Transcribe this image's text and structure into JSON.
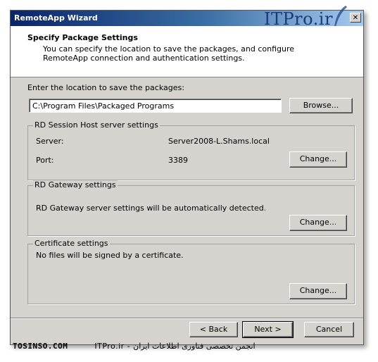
{
  "window": {
    "title": "RemoteApp Wizard",
    "logo": "ITPro.ir",
    "close_glyph": "✕"
  },
  "header": {
    "title": "Specify Package Settings",
    "description": "You can specify the location to save the packages, and configure RemoteApp connection and authentication settings."
  },
  "location": {
    "label": "Enter the location to save the packages:",
    "value": "C:\\Program Files\\Packaged Programs",
    "browse_label": "Browse..."
  },
  "rd_session": {
    "legend": "RD Session Host server settings",
    "server_label": "Server:",
    "server_value": "Server2008-L.Shams.local",
    "port_label": "Port:",
    "port_value": "3389",
    "change_label": "Change..."
  },
  "rd_gateway": {
    "legend": "RD Gateway settings",
    "text": "RD Gateway server settings will be automatically detected.",
    "change_label": "Change..."
  },
  "certificate": {
    "legend": "Certificate settings",
    "text": "No files will be signed by a certificate.",
    "change_label": "Change..."
  },
  "footer": {
    "back_label": "< Back",
    "next_label": "Next >",
    "cancel_label": "Cancel"
  },
  "watermark": {
    "left": "TOSINSO.COM",
    "right": "ITPro.ir - انجمن تخصصی فناوری اطلاعات ایران"
  },
  "colors": {
    "title_gradient_start": "#0a246a",
    "title_gradient_end": "#a6caf0",
    "dialog_face": "#d6d3ce",
    "logo": "#1b3a78"
  }
}
